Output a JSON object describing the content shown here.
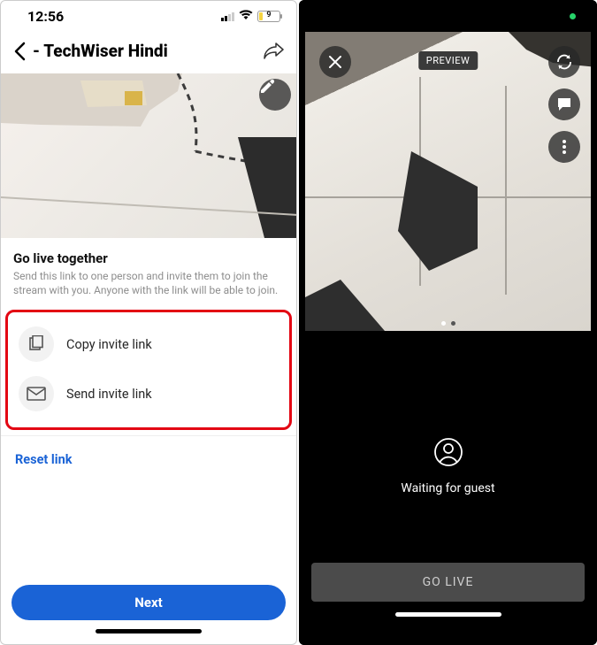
{
  "left": {
    "status": {
      "time": "12:56",
      "battery_label": "9"
    },
    "header": {
      "title": "- TechWiser Hindi"
    },
    "section": {
      "title": "Go live together",
      "subtitle": "Send this link to one person and invite them to join the stream with you. Anyone with the link will be able to join."
    },
    "actions": {
      "copy": "Copy invite link",
      "send": "Send invite link"
    },
    "reset": "Reset link",
    "next": "Next"
  },
  "right": {
    "preview_badge": "PREVIEW",
    "waiting": "Waiting for guest",
    "go_live": "GO LIVE"
  }
}
